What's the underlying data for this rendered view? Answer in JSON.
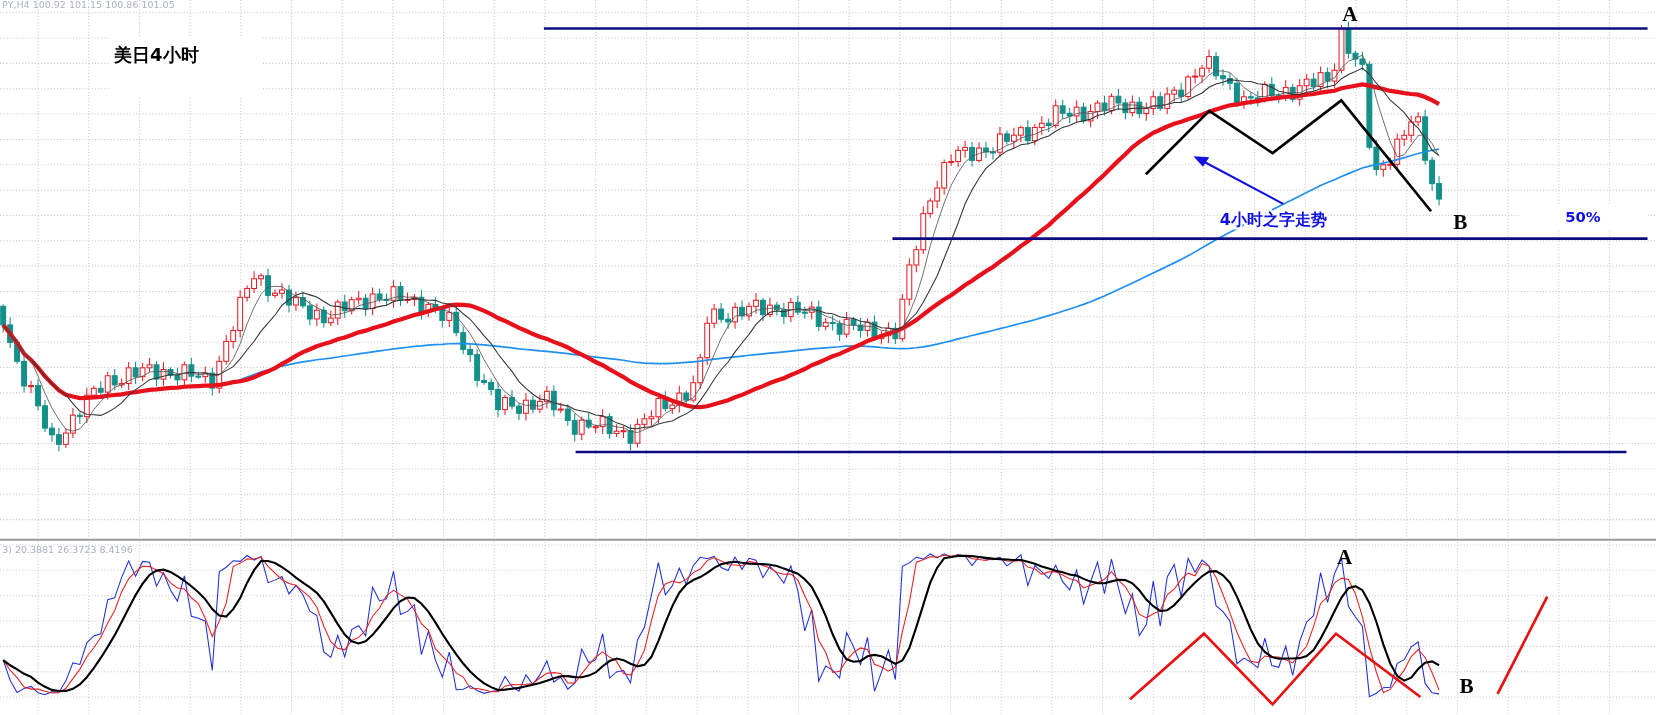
{
  "chart_header": "PY,H4 100.92 101.15 100.86 101.05",
  "title": "美日4小时",
  "peak_label": "A",
  "trough_label": "B",
  "annotation": "4小时之字走势",
  "level_label": "50%",
  "indicator_header": "3) 20.3881 26.3723 8.4196",
  "indicator_peak_label": "A",
  "indicator_trough_label": "B"
}
